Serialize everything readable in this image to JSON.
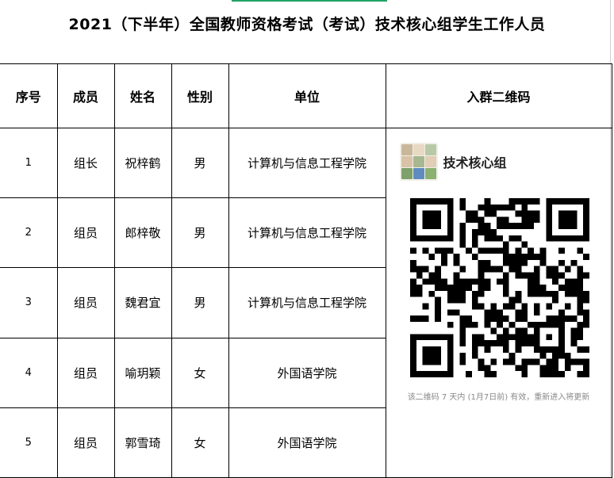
{
  "title": "2021（下半年）全国教师资格考试（考试）技术核心组学生工作人员",
  "headers": [
    "序号",
    "成员",
    "姓名",
    "性别",
    "单位",
    "入群二维码"
  ],
  "rows": [
    {
      "no": "1",
      "role": "组长",
      "name": "祝梓鹤",
      "gender": "男",
      "unit": "计算机与信息工程学院"
    },
    {
      "no": "2",
      "role": "组员",
      "name": "郎梓敬",
      "gender": "男",
      "unit": "计算机与信息工程学院"
    },
    {
      "no": "3",
      "role": "组员",
      "name": "魏君宜",
      "gender": "男",
      "unit": "计算机与信息工程学院"
    },
    {
      "no": "4",
      "role": "组员",
      "name": "喻玥颖",
      "gender": "女",
      "unit": "外国语学院"
    },
    {
      "no": "5",
      "role": "组员",
      "name": "郭雪琦",
      "gender": "女",
      "unit": "外国语学院"
    }
  ],
  "qr": {
    "group_name": "技术核心组",
    "note": "该二维码 7 天内 (1月7日前) 有效，重新进入将更新",
    "icon": "qr-code-icon",
    "avatar_icon": "group-avatar-icon"
  },
  "colors": {
    "accent": "#21a366",
    "border": "#000000",
    "note": "#888888"
  }
}
